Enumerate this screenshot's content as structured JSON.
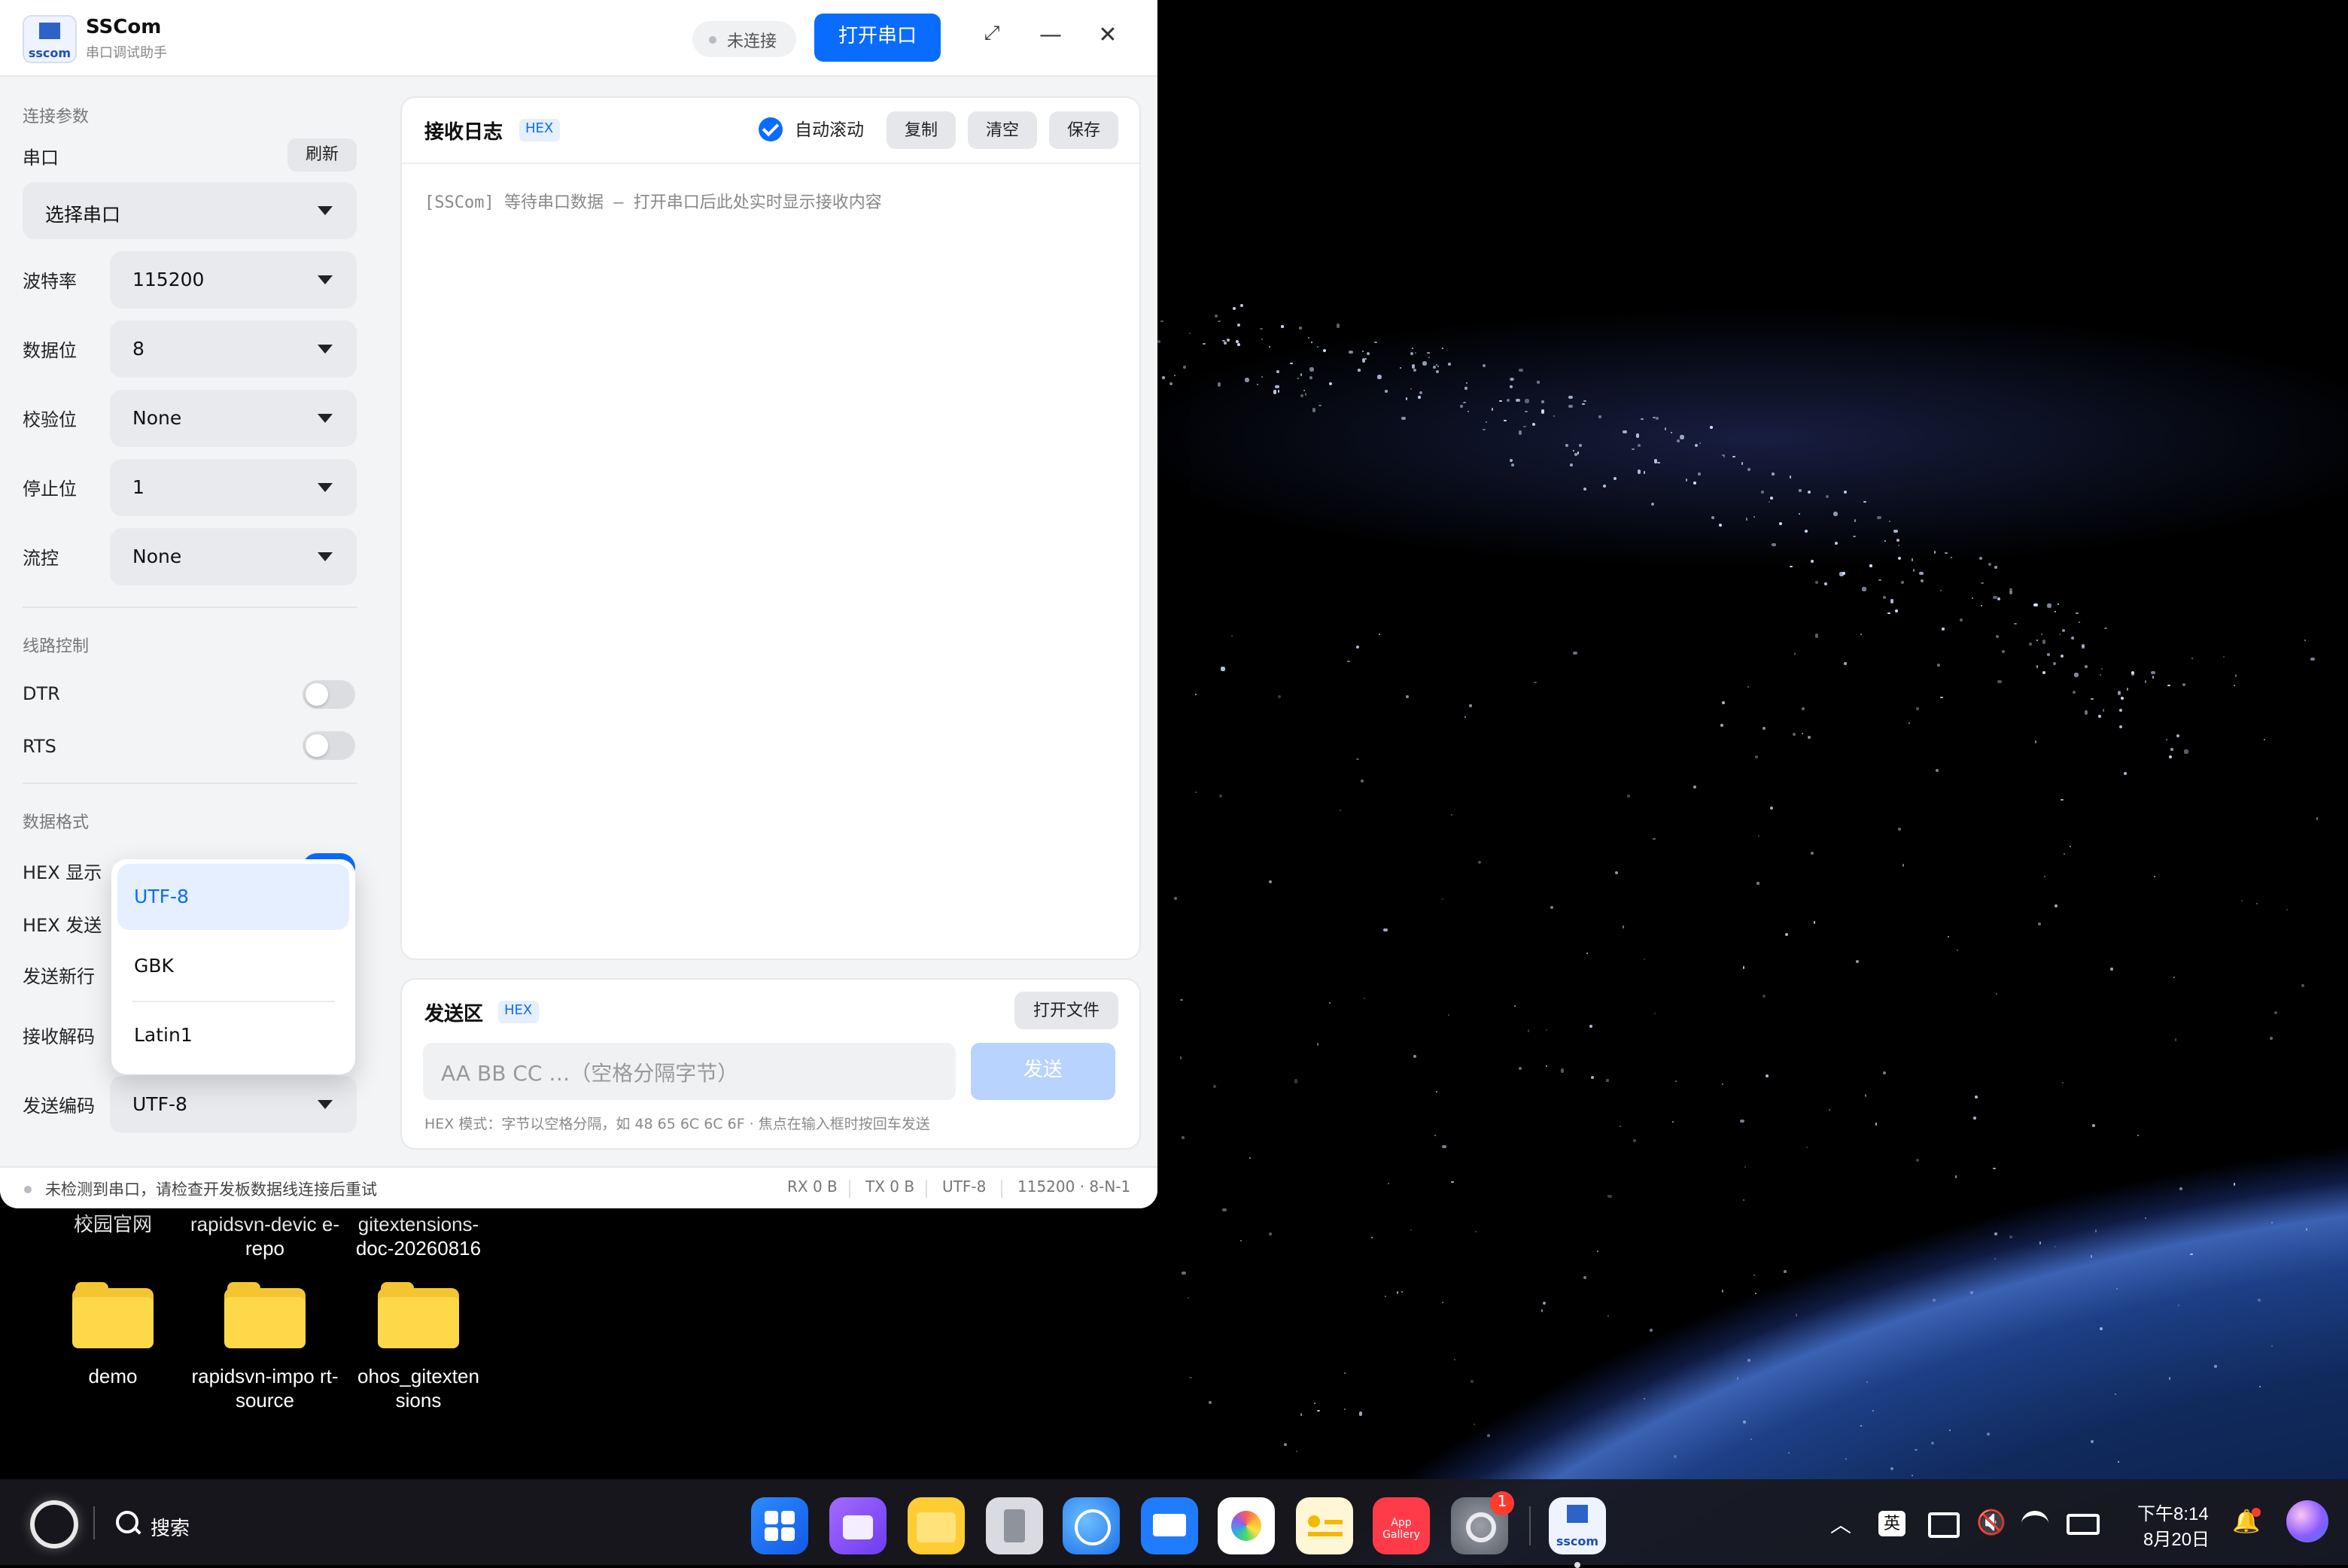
{
  "app": {
    "name": "SSCom",
    "subtitle": "串口调试助手",
    "logo_text": "sscom"
  },
  "titlebar": {
    "status": "未连接",
    "open_button": "打开串口",
    "maximize_icon": "⤢",
    "minimize_icon": "—",
    "close_icon": "✕"
  },
  "sidebar": {
    "connection_title": "连接参数",
    "port_label": "串口",
    "refresh_button": "刷新",
    "port_value": "选择串口",
    "baud_label": "波特率",
    "baud_value": "115200",
    "databits_label": "数据位",
    "databits_value": "8",
    "parity_label": "校验位",
    "parity_value": "None",
    "stopbits_label": "停止位",
    "stopbits_value": "1",
    "flow_label": "流控",
    "flow_value": "None",
    "line_title": "线路控制",
    "dtr_label": "DTR",
    "dtr_on": false,
    "rts_label": "RTS",
    "rts_on": false,
    "format_title": "数据格式",
    "hex_display_label": "HEX 显示",
    "hex_send_label": "HEX 发送",
    "send_newline_label": "发送新行",
    "recv_decode_label": "接收解码",
    "send_encode_label": "发送编码",
    "send_encode_value": "UTF-8"
  },
  "dropdown": {
    "options": [
      "UTF-8",
      "GBK",
      "Latin1"
    ],
    "selected": "UTF-8"
  },
  "receive": {
    "title": "接收日志",
    "hex_tag": "HEX",
    "autoscroll_label": "自动滚动",
    "autoscroll_on": true,
    "copy_button": "复制",
    "clear_button": "清空",
    "save_button": "保存",
    "log_line": "[SSCom] 等待串口数据 — 打开串口后此处实时显示接收内容"
  },
  "send": {
    "title": "发送区",
    "hex_tag": "HEX",
    "open_file_button": "打开文件",
    "input_placeholder": "AA BB CC …（空格分隔字节）",
    "send_button": "发送",
    "hint": "HEX 模式：字节以空格分隔，如 48 65 6C 6C 6F · 焦点在输入框时按回车发送"
  },
  "statusbar": {
    "message": "未检测到串口，请检查开发板数据线连接后重试",
    "rx": "RX 0 B",
    "tx": "TX 0 B",
    "encoding": "UTF-8",
    "serial_config": "115200 · 8-N-1"
  },
  "desktop": {
    "icons_top": [
      "校园官网",
      "rapidsvn-devic e-repo",
      "gitextensions- doc-20260816"
    ],
    "folders": [
      "demo",
      "rapidsvn-impo rt-source",
      "ohos_gitexten sions"
    ]
  },
  "taskbar": {
    "search_label": "搜索",
    "ime_label": "英",
    "time": "下午8:14",
    "date": "8月20日",
    "settings_badge": "1",
    "app_gallery_label": "App Gallery",
    "sscom_label": "sscom"
  }
}
